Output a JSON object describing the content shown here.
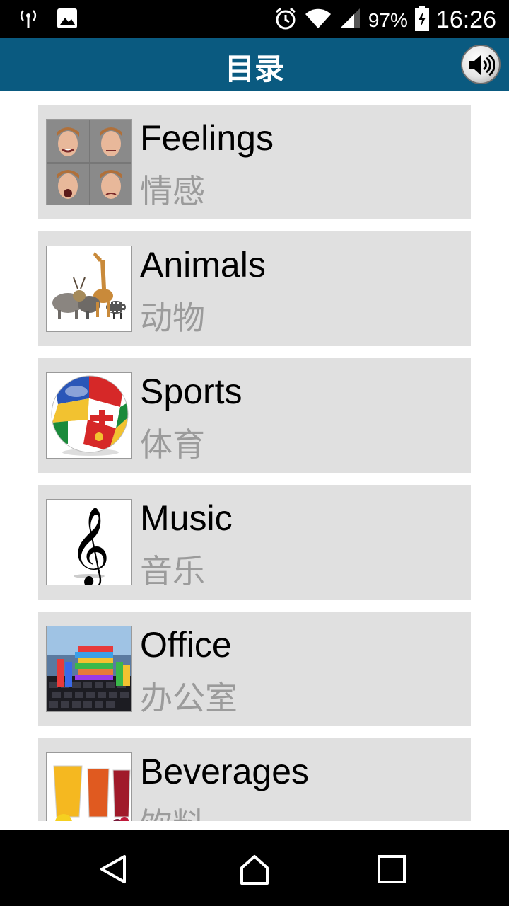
{
  "status_bar": {
    "battery_percent": "97%",
    "time": "16:26",
    "icons": [
      "antenna-icon",
      "image-notification-icon",
      "alarm-icon",
      "wifi-icon",
      "cell-signal-icon",
      "battery-charging-icon"
    ]
  },
  "app_bar": {
    "title": "目录",
    "sound_icon": "speaker-volume-icon"
  },
  "categories": [
    {
      "en": "Feelings",
      "zh": "情感",
      "thumb": "faces-grid"
    },
    {
      "en": "Animals",
      "zh": "动物",
      "thumb": "animals-group"
    },
    {
      "en": "Sports",
      "zh": "体育",
      "thumb": "flag-soccer-ball"
    },
    {
      "en": "Music",
      "zh": "音乐",
      "thumb": "treble-clef"
    },
    {
      "en": "Office",
      "zh": "办公室",
      "thumb": "binders-keyboard"
    },
    {
      "en": "Beverages",
      "zh": "饮料",
      "thumb": "juice-glasses"
    }
  ],
  "nav_bar": {
    "icons": [
      "back-triangle-icon",
      "home-icon",
      "recents-square-icon"
    ]
  },
  "colors": {
    "app_bar": "#0a5a80",
    "card_bg": "#e0e0e0",
    "zh_text": "#9b9b9b"
  }
}
